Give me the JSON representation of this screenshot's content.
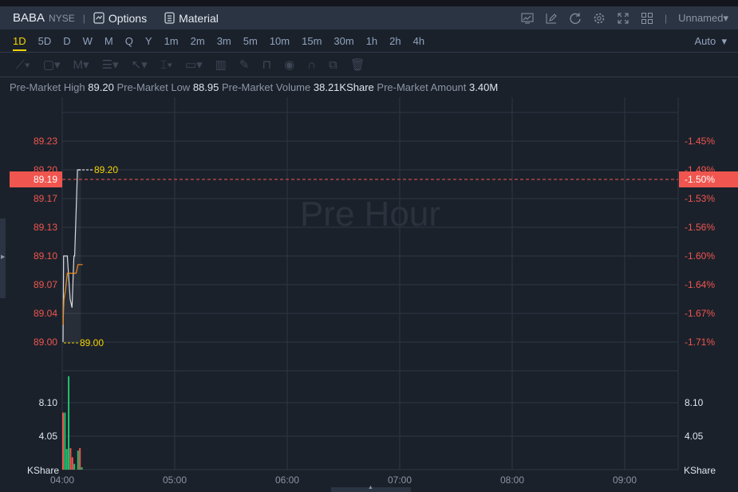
{
  "header": {
    "symbol": "BABA",
    "exchange": "NYSE",
    "options_label": "Options",
    "material_label": "Material",
    "layout_name": "Unnamed"
  },
  "timeframes": [
    "1D",
    "5D",
    "D",
    "W",
    "M",
    "Q",
    "Y",
    "1m",
    "2m",
    "3m",
    "5m",
    "10m",
    "15m",
    "30m",
    "1h",
    "2h",
    "4h"
  ],
  "active_timeframe": "1D",
  "scale_mode": "Auto",
  "info": {
    "high_label": "Pre-Market High",
    "high": "89.20",
    "low_label": "Pre-Market Low",
    "low": "88.95",
    "volume_label": "Pre-Market Volume",
    "volume": "38.21KShare",
    "amount_label": "Pre-Market Amount",
    "amount": "3.40M"
  },
  "chart_data": {
    "type": "line",
    "watermark": "Pre Hour",
    "price_ticks": [
      "89.23",
      "89.20",
      "89.17",
      "89.13",
      "89.10",
      "89.07",
      "89.04",
      "89.00"
    ],
    "pct_ticks": [
      "-1.45%",
      "-1.49%",
      "-1.53%",
      "-1.56%",
      "-1.60%",
      "-1.64%",
      "-1.67%",
      "-1.71%"
    ],
    "current_price": "89.19",
    "current_pct": "-1.50%",
    "high_marker": "89.20",
    "low_marker": "89.00",
    "price_minutes": [
      0,
      0.3,
      1.3,
      2.3,
      3.8,
      4.8,
      5.8,
      6.2,
      7.7,
      8.4,
      9.5
    ],
    "price": [
      89.0,
      89.1,
      89.1,
      89.1,
      89.05,
      89.04,
      89.1,
      89.1,
      89.2,
      89.2,
      89.2
    ],
    "avg_minutes": [
      0,
      0.5,
      1.3,
      2.3,
      3,
      5,
      7,
      8,
      9.5,
      10.5
    ],
    "avg": [
      89.02,
      89.05,
      89.06,
      89.08,
      89.08,
      89.08,
      89.08,
      89.09,
      89.09,
      89.09
    ],
    "volume_ticks": [
      "8.10",
      "4.05"
    ],
    "volume_unit": "KShare",
    "volume": [
      {
        "m": 0,
        "v": 6.9,
        "dir": "down"
      },
      {
        "m": 1,
        "v": 6.9,
        "dir": "up"
      },
      {
        "m": 2,
        "v": 2.5,
        "dir": "up"
      },
      {
        "m": 3,
        "v": 11.3,
        "dir": "up"
      },
      {
        "m": 4,
        "v": 2.6,
        "dir": "down"
      },
      {
        "m": 5,
        "v": 1.5,
        "dir": "down"
      },
      {
        "m": 6,
        "v": 0.7,
        "dir": "up"
      },
      {
        "m": 8,
        "v": 2.3,
        "dir": "up"
      },
      {
        "m": 9,
        "v": 2.6,
        "dir": "down"
      },
      {
        "m": 10,
        "v": 0.3,
        "dir": "up"
      }
    ],
    "time_ticks": [
      "04:00",
      "05:00",
      "06:00",
      "07:00",
      "08:00",
      "09:00"
    ],
    "colors": {
      "up": "#1fc26f",
      "down": "#f0564f",
      "price_line": "#d6dae0",
      "avg_line": "#f08c1a",
      "marker": "#f5d400",
      "axis_red": "#f0564f"
    }
  }
}
